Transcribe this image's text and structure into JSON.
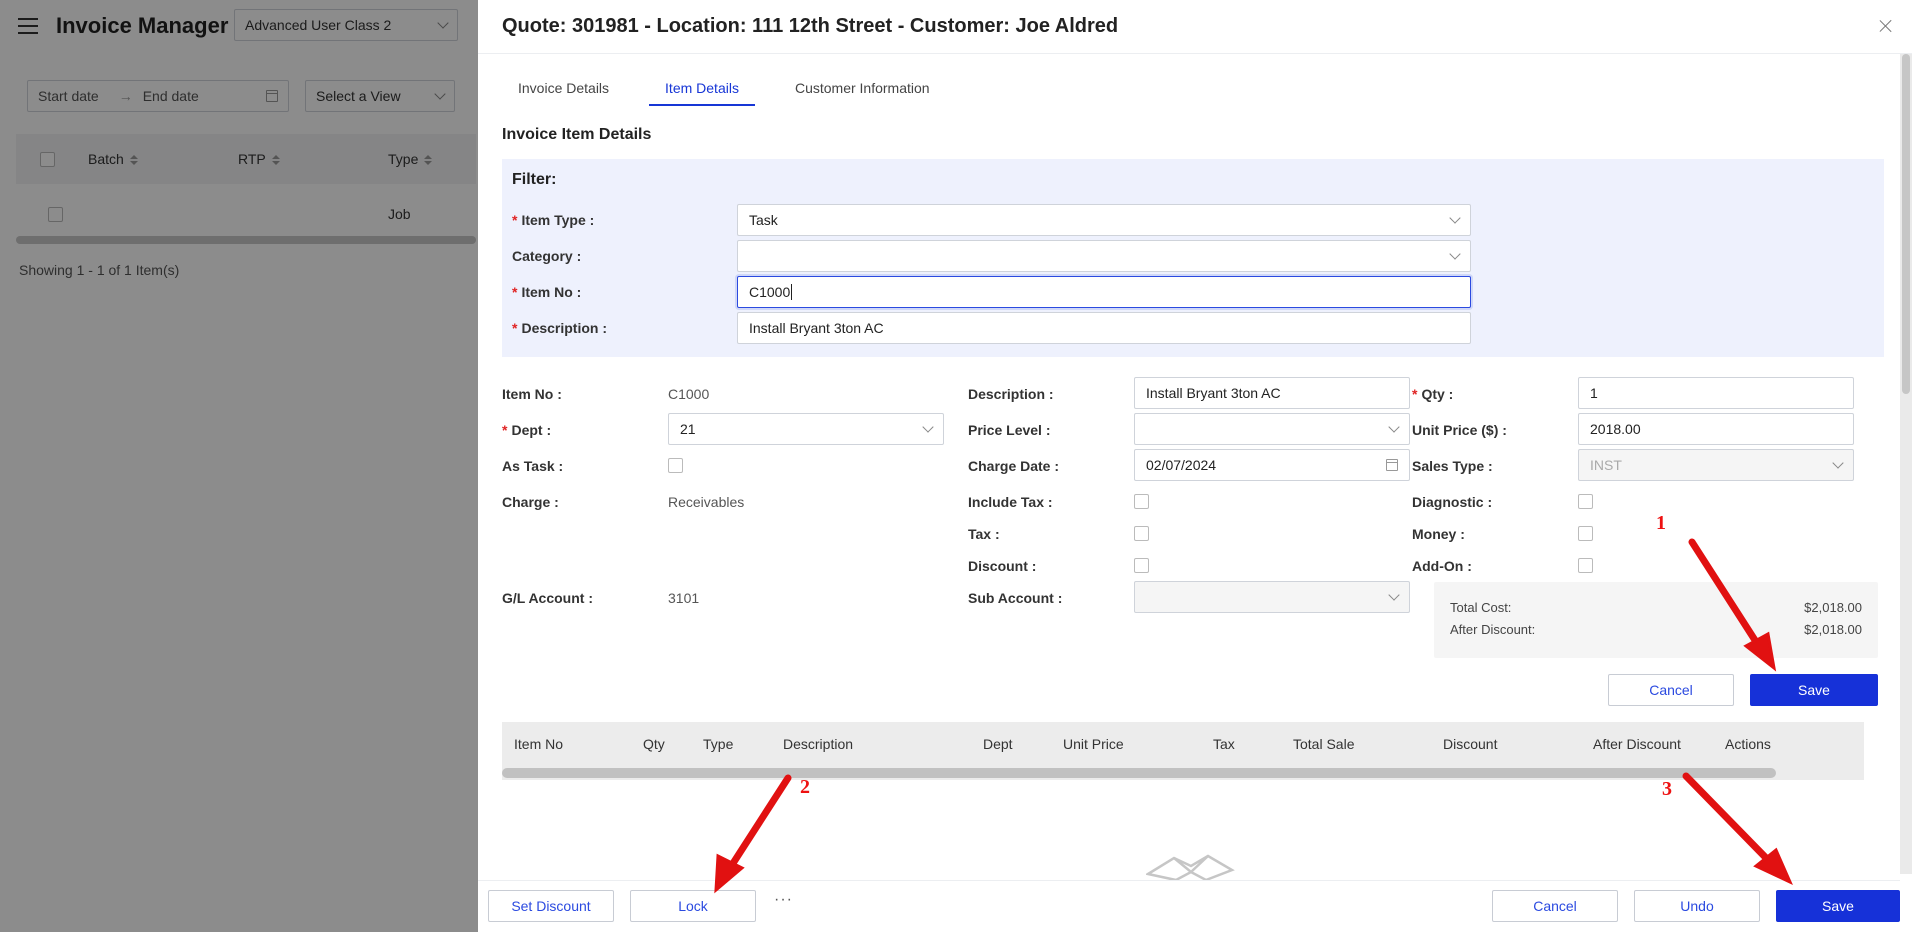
{
  "background": {
    "app_title": "Invoice Manager",
    "class_select": "Advanced User Class 2",
    "start_date_placeholder": "Start date",
    "end_date_placeholder": "End date",
    "view_select": "Select a View",
    "columns": [
      "Batch",
      "RTP",
      "Type"
    ],
    "row_type": "Job",
    "showing": "Showing 1 - 1 of 1 Item(s)"
  },
  "drawer": {
    "title": "Quote: 301981 - Location: 111 12th Street - Customer: Joe Aldred",
    "tabs": [
      "Invoice Details",
      "Item Details",
      "Customer Information"
    ],
    "active_tab": "Item Details",
    "section_title": "Invoice Item Details",
    "filter": {
      "title": "Filter:",
      "item_type_label": "Item Type :",
      "item_type_value": "Task",
      "category_label": "Category :",
      "category_value": "",
      "item_no_label": "Item No :",
      "item_no_value": "C1000",
      "description_label": "Description :",
      "description_value": "Install Bryant 3ton AC"
    },
    "details": {
      "item_no_label": "Item No :",
      "item_no_value": "C1000",
      "dept_label": "Dept :",
      "dept_value": "21",
      "as_task_label": "As Task :",
      "charge_label": "Charge :",
      "charge_value": "Receivables",
      "gl_account_label": "G/L Account :",
      "gl_account_value": "3101",
      "description_label": "Description :",
      "description_value": "Install Bryant 3ton AC",
      "price_level_label": "Price Level :",
      "price_level_value": "",
      "charge_date_label": "Charge Date :",
      "charge_date_value": "02/07/2024",
      "include_tax_label": "Include Tax :",
      "tax_label": "Tax :",
      "discount_label": "Discount :",
      "sub_account_label": "Sub Account :",
      "qty_label": "Qty :",
      "qty_value": "1",
      "unit_price_label": "Unit Price ($) :",
      "unit_price_value": "2018.00",
      "sales_type_label": "Sales Type :",
      "sales_type_value": "INST",
      "diagnostic_label": "Diagnostic :",
      "money_label": "Money :",
      "addon_label": "Add-On :"
    },
    "totals": {
      "total_cost_label": "Total Cost:",
      "total_cost_value": "$2,018.00",
      "after_discount_label": "After Discount:",
      "after_discount_value": "$2,018.00"
    },
    "item_buttons": {
      "cancel": "Cancel",
      "save": "Save"
    },
    "table_columns": [
      "Item No",
      "Qty",
      "Type",
      "Description",
      "Dept",
      "Unit Price",
      "Tax",
      "Total Sale",
      "Discount",
      "After Discount",
      "Actions"
    ],
    "footer": {
      "set_discount": "Set Discount",
      "lock": "Lock",
      "more": "···",
      "cancel": "Cancel",
      "undo": "Undo",
      "save": "Save"
    }
  },
  "annotations": [
    "1",
    "2",
    "3"
  ],
  "colors": {
    "primary": "#1631d8",
    "link": "#2b4ae0",
    "required": "#e02424",
    "annotation": "#e11111"
  }
}
